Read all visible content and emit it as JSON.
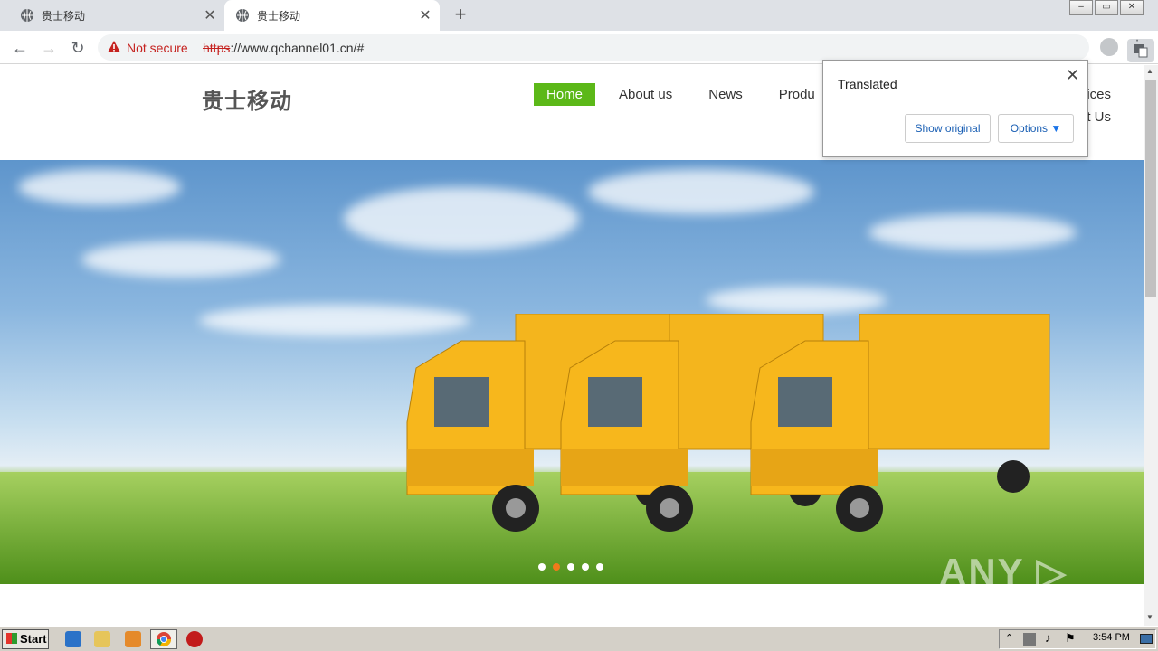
{
  "browser": {
    "tabs": [
      {
        "title": "贵士移动",
        "close": "✕"
      },
      {
        "title": "贵士移动",
        "close": "✕"
      }
    ],
    "new_tab": "+",
    "security_label": "Not secure",
    "url_scheme": "https",
    "url_rest": "://www.qchannel01.cn/#",
    "window_controls": [
      "–",
      "▭",
      "✕"
    ]
  },
  "site": {
    "logo": "贵士移动",
    "nav": [
      {
        "label": "Home",
        "active": true
      },
      {
        "label": "About us"
      },
      {
        "label": "News"
      },
      {
        "label": "Produ"
      }
    ],
    "nav_right_1": "ices",
    "nav_right_2": "t Us",
    "carousel_dots": 5,
    "carousel_active_index": 1
  },
  "translate_bubble": {
    "title": "Translated",
    "close": "✕",
    "show_original": "Show original",
    "options": "Options"
  },
  "watermark": "ANY ▷ RUN",
  "taskbar": {
    "start_label": "Start",
    "clock": "3:54 PM"
  },
  "colors": {
    "nav_active": "#5cb818",
    "dot_active": "#f07a1a",
    "not_secure": "#c5221f"
  }
}
